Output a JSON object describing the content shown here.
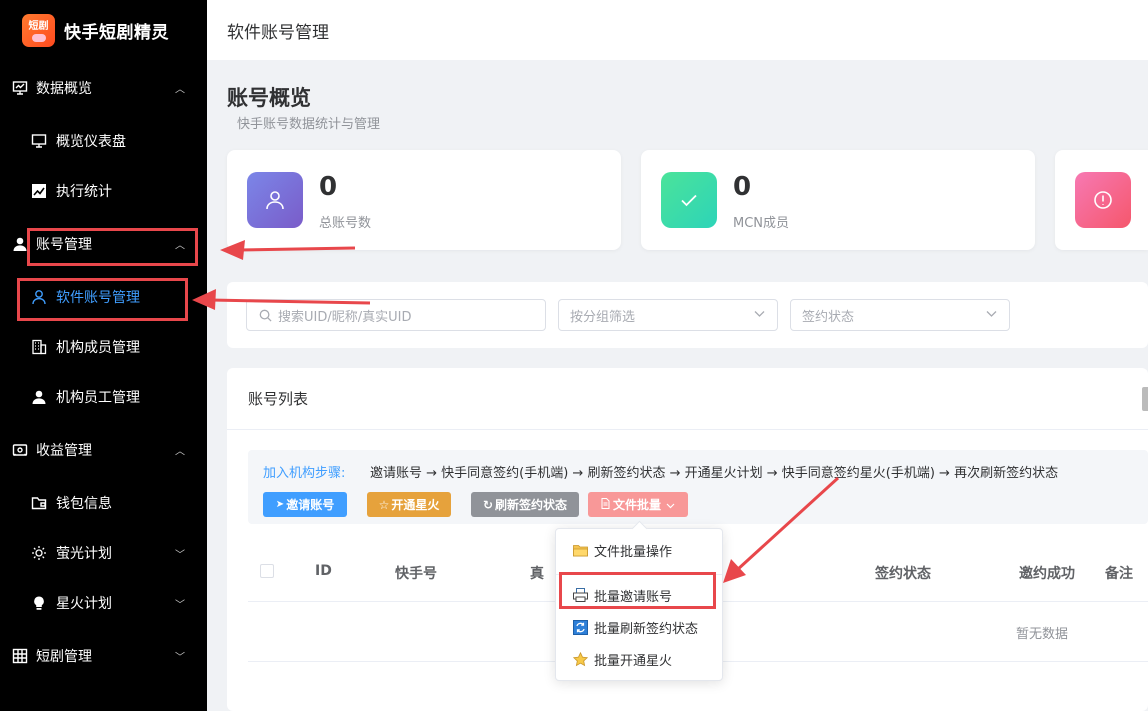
{
  "brand": {
    "logo_text": "短剧",
    "name": "快手短剧精灵"
  },
  "topbar": {
    "title": "软件账号管理"
  },
  "sidebar": {
    "groups": [
      {
        "label": "数据概览",
        "arrow": "︿"
      },
      {
        "label": "账号管理",
        "arrow": "︿"
      },
      {
        "label": "收益管理",
        "arrow": "︿"
      },
      {
        "label": "短剧管理",
        "arrow": "﹀"
      }
    ],
    "items": [
      {
        "label": "概览仪表盘"
      },
      {
        "label": "执行统计"
      },
      {
        "label": "软件账号管理"
      },
      {
        "label": "机构成员管理"
      },
      {
        "label": "机构员工管理"
      },
      {
        "label": "钱包信息"
      },
      {
        "label": "萤光计划",
        "arrow": "﹀"
      },
      {
        "label": "星火计划",
        "arrow": "﹀"
      }
    ]
  },
  "page": {
    "title": "账号概览",
    "subtitle": "快手账号数据统计与管理"
  },
  "stats": [
    {
      "value": "0",
      "label": "总账号数",
      "color_from": "#7b86e8",
      "color_to": "#7a5cc9"
    },
    {
      "value": "0",
      "label": "MCN成员",
      "color_from": "#4be39a",
      "color_to": "#2dd4b8"
    },
    {
      "value": "",
      "label": "",
      "color_from": "#f779b3",
      "color_to": "#f5576c"
    }
  ],
  "filters": {
    "search_placeholder": "搜索UID/昵称/真实UID",
    "group_placeholder": "按分组筛选",
    "sign_placeholder": "签约状态"
  },
  "list": {
    "title": "账号列表",
    "steps_label": "加入机构步骤:",
    "steps_text": "邀请账号 → 快手同意签约(手机端) → 刷新签约状态 → 开通星火计划 → 快手同意签约星火(手机端) → 再次刷新签约状态",
    "buttons": [
      {
        "label": "邀请账号",
        "color": "#409eff"
      },
      {
        "label": "开通星火",
        "color": "#e6a23c"
      },
      {
        "label": "刷新签约状态",
        "color": "#909399"
      },
      {
        "label": "文件批量",
        "color": "#f89898"
      }
    ],
    "columns": [
      "ID",
      "快手号",
      "真",
      "签约状态",
      "邀约成功",
      "备注"
    ],
    "empty_text": "暂无数据"
  },
  "dropdown": {
    "items": [
      {
        "label": "文件批量操作",
        "icon": "folder-icon"
      },
      {
        "label": "批量邀请账号",
        "icon": "printer-icon"
      },
      {
        "label": "批量刷新签约状态",
        "icon": "refresh-icon"
      },
      {
        "label": "批量开通星火",
        "icon": "star-icon"
      }
    ]
  },
  "colors": {
    "accent": "#409eff",
    "annotation": "#e8474b",
    "sidebar_bg": "#000000"
  }
}
